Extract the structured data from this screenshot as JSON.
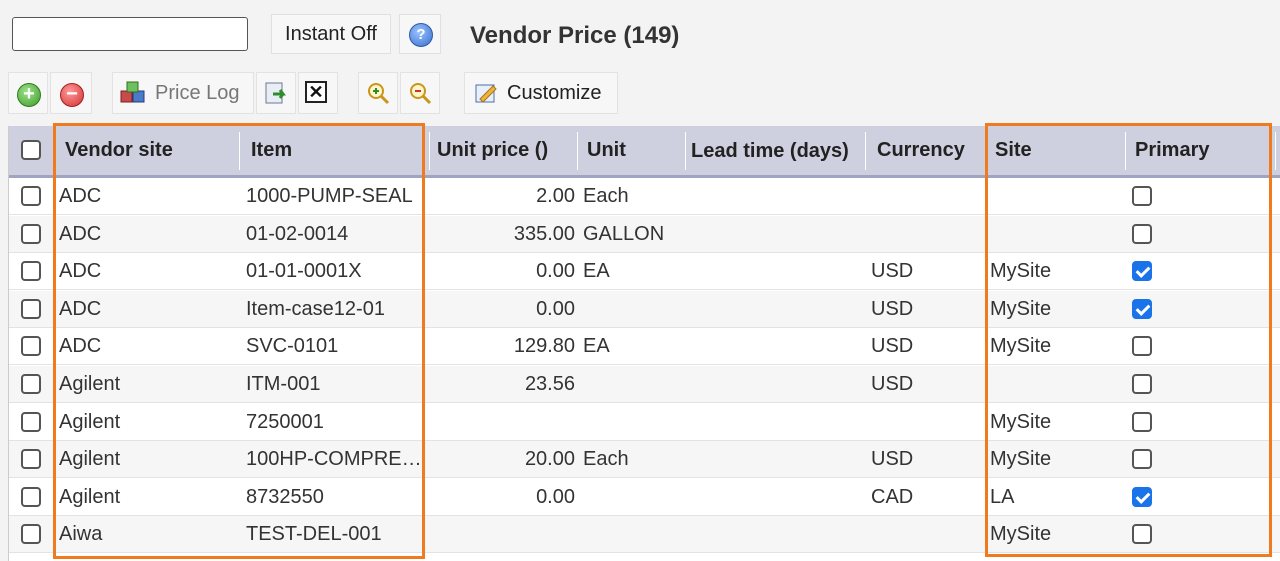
{
  "search": {
    "value": ""
  },
  "instant_button": {
    "label": "Instant Off"
  },
  "help_icon": "question-circle-icon",
  "page_title": "Vendor Price (149)",
  "toolbar": {
    "add_icon": "add-circle-icon",
    "remove_icon": "remove-circle-icon",
    "price_log_label": "Price Log",
    "customize_label": "Customize"
  },
  "table": {
    "columns": {
      "vendor_site": "Vendor site",
      "item": "Item",
      "unit_price": "Unit price ()",
      "unit": "Unit",
      "lead_time": "Lead time (days)",
      "currency": "Currency",
      "site": "Site",
      "primary": "Primary"
    },
    "rows": [
      {
        "vendor_site": "ADC",
        "item": "1000-PUMP-SEAL",
        "unit_price": "2.00",
        "unit": "Each",
        "currency": "",
        "site": "",
        "primary": false
      },
      {
        "vendor_site": "ADC",
        "item": "01-02-0014",
        "unit_price": "335.00",
        "unit": "GALLON",
        "currency": "",
        "site": "",
        "primary": false
      },
      {
        "vendor_site": "ADC",
        "item": "01-01-0001X",
        "unit_price": "0.00",
        "unit": "EA",
        "currency": "USD",
        "site": "MySite",
        "primary": true
      },
      {
        "vendor_site": "ADC",
        "item": "Item-case12-01",
        "unit_price": "0.00",
        "unit": "",
        "currency": "USD",
        "site": "MySite",
        "primary": true
      },
      {
        "vendor_site": "ADC",
        "item": "SVC-0101",
        "unit_price": "129.80",
        "unit": "EA",
        "currency": "USD",
        "site": "MySite",
        "primary": false
      },
      {
        "vendor_site": "Agilent",
        "item": "ITM-001",
        "unit_price": "23.56",
        "unit": "",
        "currency": "USD",
        "site": "",
        "primary": false
      },
      {
        "vendor_site": "Agilent",
        "item": "7250001",
        "unit_price": "",
        "unit": "",
        "currency": "",
        "site": "MySite",
        "primary": false
      },
      {
        "vendor_site": "Agilent",
        "item": "100HP-COMPRE…",
        "unit_price": "20.00",
        "unit": "Each",
        "currency": "USD",
        "site": "MySite",
        "primary": false
      },
      {
        "vendor_site": "Agilent",
        "item": "8732550",
        "unit_price": "0.00",
        "unit": "",
        "currency": "CAD",
        "site": "LA",
        "primary": true
      },
      {
        "vendor_site": "Aiwa",
        "item": "TEST-DEL-001",
        "unit_price": "",
        "unit": "",
        "currency": "",
        "site": "MySite",
        "primary": false
      }
    ]
  },
  "highlight_color": "#f07b1e",
  "checkbox_checked_color": "#1a73e8"
}
